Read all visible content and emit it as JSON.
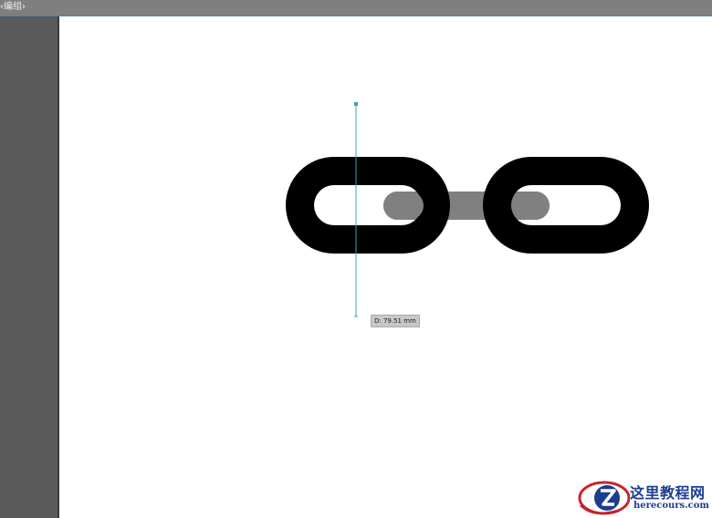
{
  "topbar": {
    "breadcrumb": "‹编组›"
  },
  "canvas": {
    "measure_readout": "D: 79.51 mm"
  },
  "watermark": {
    "brand_cn": "这里教程网",
    "brand_en": "herecours.com"
  },
  "colors": {
    "link_fill": "#000000",
    "connector_fill": "#808080",
    "guide_line": "#3f9fbf",
    "brand": "#1d3d8f"
  },
  "icons": {
    "selection_anchor": "guide-anchor-icon",
    "logo": "z-logo-icon"
  }
}
